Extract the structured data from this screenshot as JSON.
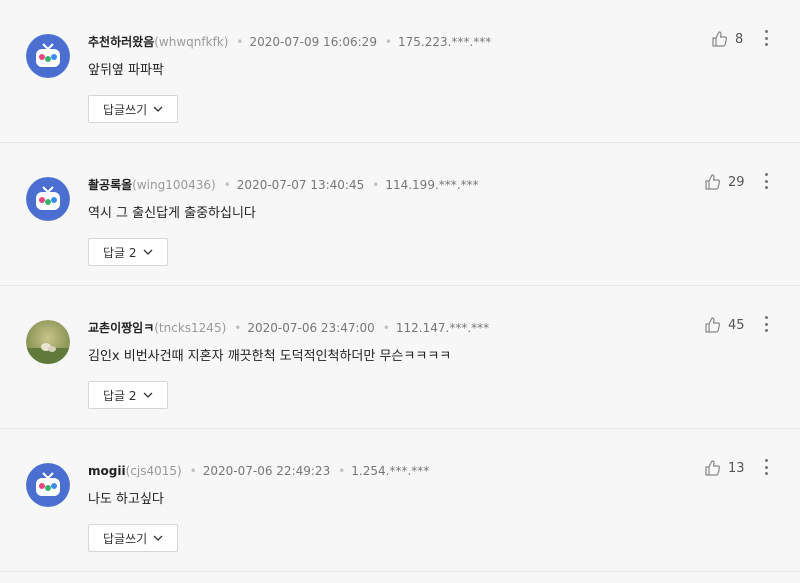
{
  "comments": [
    {
      "nickname": "추천하러왔음",
      "user_id": "(whwqnfkfk)",
      "date": "2020-07-09 16:06:29",
      "ip": "175.223.***.***",
      "text": "앞뒤옆 파파팍",
      "reply_label": "답글쓰기",
      "likes": "8",
      "avatar": "robot-avatar-icon"
    },
    {
      "nickname": "촬공록올",
      "user_id": "(wing100436)",
      "date": "2020-07-07 13:40:45",
      "ip": "114.199.***.***",
      "text": "역시 그 출신답게 출중하십니다",
      "reply_label": "답글 2",
      "likes": "29",
      "avatar": "robot-avatar-icon"
    },
    {
      "nickname": "교촌이짱임ㅋ",
      "user_id": "(tncks1245)",
      "date": "2020-07-06 23:47:00",
      "ip": "112.147.***.***",
      "text": "김인x 비번사건때 지혼자 깨끗한척 도덕적인척하더만 무슨ㅋㅋㅋㅋ",
      "reply_label": "답글 2",
      "likes": "45",
      "avatar": "photo-avatar"
    },
    {
      "nickname": "mogii",
      "user_id": "(cjs4015)",
      "date": "2020-07-06 22:49:23",
      "ip": "1.254.***.***",
      "text": "나도 하고싶다",
      "reply_label": "답글쓰기",
      "likes": "13",
      "avatar": "robot-avatar-icon"
    }
  ],
  "colors": {
    "background": "#f7f7f8",
    "avatar_blue": "#4a6fd0",
    "border": "#e6e6e8"
  }
}
